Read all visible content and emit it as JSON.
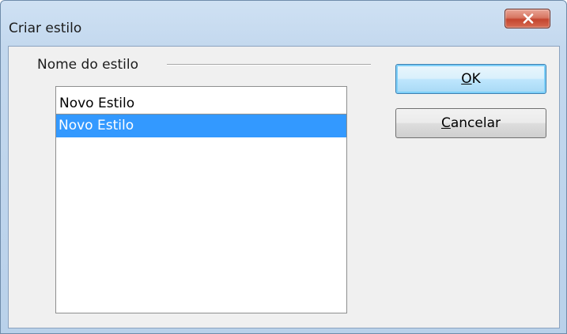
{
  "window": {
    "title": "Criar estilo",
    "close_icon": "close-x-icon"
  },
  "group": {
    "label": "Nome do estilo"
  },
  "style_name_input": {
    "value": "Novo Estilo"
  },
  "style_list": {
    "items": [
      {
        "label": "Novo Estilo",
        "selected": true
      }
    ]
  },
  "buttons": {
    "ok": {
      "mnemonic": "O",
      "rest": "K"
    },
    "cancel": {
      "mnemonic": "C",
      "rest": "ancelar"
    }
  },
  "colors": {
    "selection": "#3399ff",
    "close_button": "#c4452f"
  }
}
